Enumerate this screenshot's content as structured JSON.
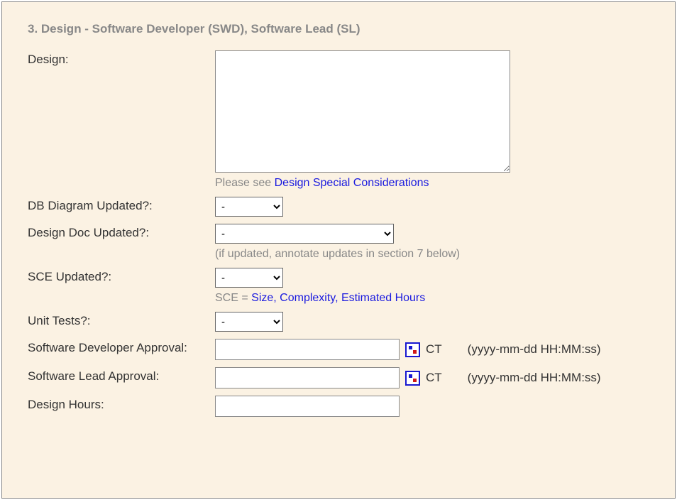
{
  "section": {
    "title": "3. Design - Software Developer (SWD), Software Lead (SL)"
  },
  "design": {
    "label": "Design:",
    "value": "",
    "hint_prefix": "Please see ",
    "hint_link": "Design Special Considerations"
  },
  "db_diagram": {
    "label": "DB Diagram Updated?:",
    "selected": "-"
  },
  "design_doc": {
    "label": "Design Doc Updated?:",
    "selected": "-",
    "hint": "(if updated, annotate updates in section 7 below)"
  },
  "sce": {
    "label": "SCE Updated?:",
    "selected": "-",
    "hint_prefix": "SCE = ",
    "hint_link": "Size, Complexity, Estimated Hours"
  },
  "unit_tests": {
    "label": "Unit Tests?:",
    "selected": "-"
  },
  "swd_approval": {
    "label": "Software Developer Approval:",
    "value": "",
    "tz": "CT",
    "fmt": "(yyyy-mm-dd HH:MM:ss)"
  },
  "sl_approval": {
    "label": "Software Lead Approval:",
    "value": "",
    "tz": "CT",
    "fmt": "(yyyy-mm-dd HH:MM:ss)"
  },
  "design_hours": {
    "label": "Design Hours:",
    "value": ""
  }
}
